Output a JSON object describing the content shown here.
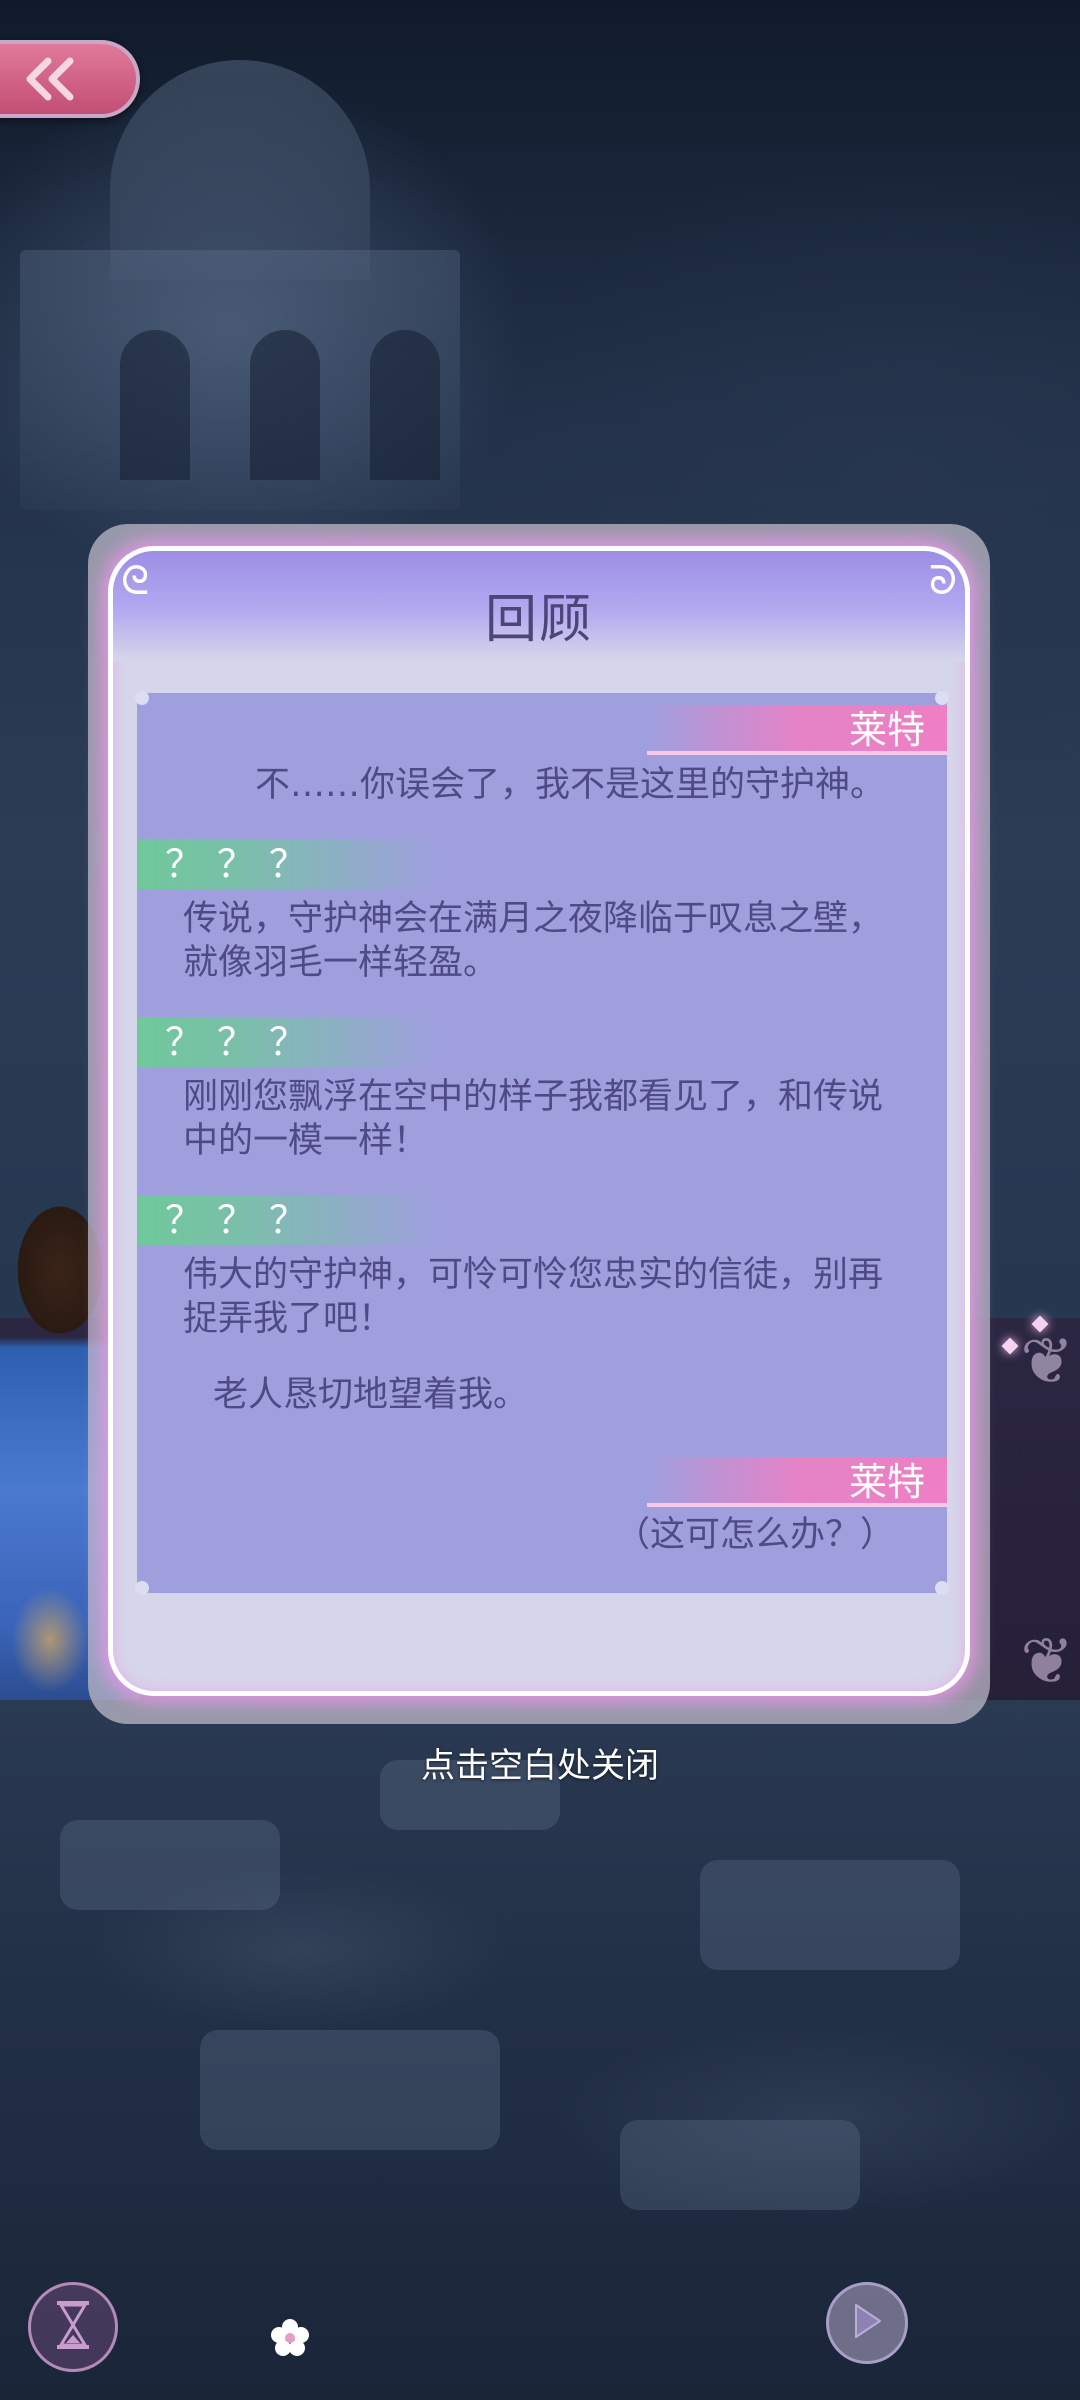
{
  "dialog": {
    "title": "回顾"
  },
  "entries": [
    {
      "speaker": "莱特",
      "text": "不……你误会了，我不是这里的守护神。"
    },
    {
      "speaker": "？？？",
      "lines": [
        "传说，守护神会在满月之夜降临于叹息之壁，",
        "就像羽毛一样轻盈。"
      ]
    },
    {
      "speaker": "？？？",
      "lines": [
        "刚刚您飘浮在空中的样子我都看见了，和传说",
        "中的一模一样！"
      ]
    },
    {
      "speaker": "？？？",
      "lines": [
        "伟大的守护神，可怜可怜您忠实的信徒，别再",
        "捉弄我了吧！"
      ]
    },
    {
      "narration": "老人恳切地望着我。"
    },
    {
      "speaker": "莱特",
      "text": "（这可怎么办？）"
    }
  ],
  "close_hint": "点击空白处关闭",
  "icons": {
    "back": "double-chevron-left-icon",
    "history": "hourglass-icon",
    "flower": "flower-icon",
    "play": "play-icon"
  },
  "colors": {
    "accent_pink": "#ee7fc4",
    "accent_green": "#6fc99a",
    "panel": "#9f9fde",
    "title_text": "#4d4478",
    "body_text": "#4f4a86"
  }
}
